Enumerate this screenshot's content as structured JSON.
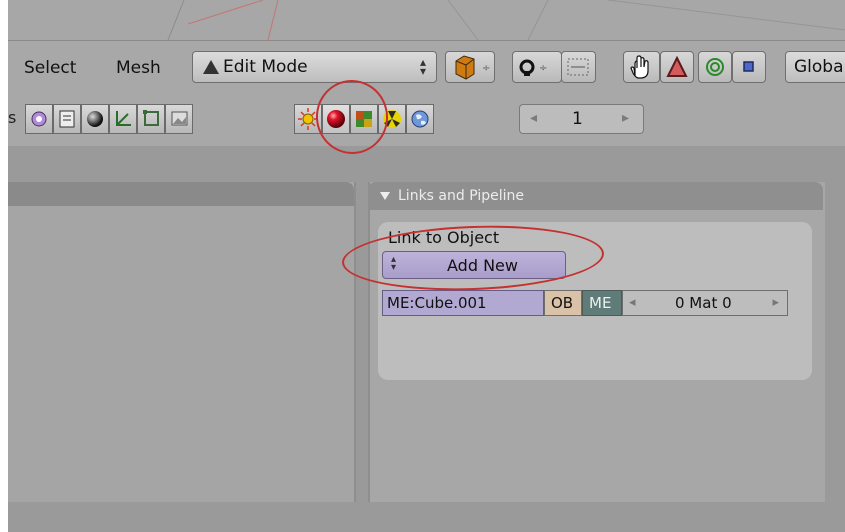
{
  "menu": {
    "select_label": "Select",
    "mesh_label": "Mesh"
  },
  "mode_select": {
    "value": "Edit Mode"
  },
  "transform_orientation": {
    "value": "Globa"
  },
  "frame": {
    "left_arrow": "◂",
    "value": "1",
    "right_arrow": "▸"
  },
  "links_panel": {
    "title": "Links and Pipeline",
    "link_to_object_label": "Link to Object",
    "add_new_label": "Add New",
    "mesh_name": "ME:Cube.001",
    "ob_label": "OB",
    "me_label": "ME",
    "mat_left": "◂",
    "mat_value": "0 Mat 0",
    "mat_right": "▸"
  },
  "colors": {
    "annotation": "#c43131",
    "material_active": "#d01020",
    "me_button": "#5f7c79",
    "add_new": "#b0a6d1"
  }
}
